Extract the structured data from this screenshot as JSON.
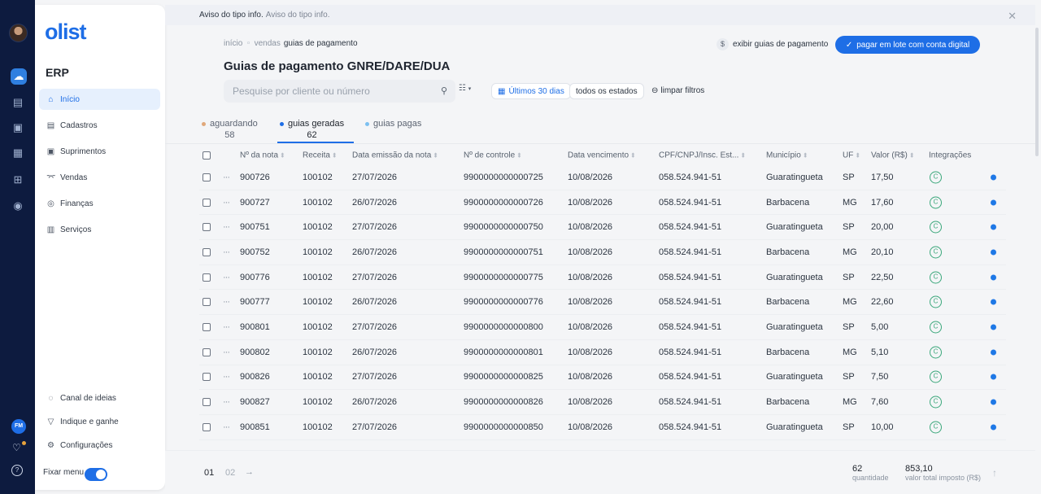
{
  "rail": {
    "icons": [
      "home-icon",
      "store-icon",
      "box-icon",
      "calendar-icon",
      "add-icon",
      "finance-icon"
    ],
    "user_initials": "FM"
  },
  "sidebar": {
    "logo": "olist",
    "section_title": "ERP",
    "items": [
      {
        "label": "Início",
        "icon": "home-icon",
        "active": true
      },
      {
        "label": "Cadastros",
        "icon": "document-icon",
        "active": false
      },
      {
        "label": "Suprimentos",
        "icon": "box-icon",
        "active": false
      },
      {
        "label": "Vendas",
        "icon": "cart-icon",
        "active": false
      },
      {
        "label": "Finanças",
        "icon": "money-icon",
        "active": false
      },
      {
        "label": "Serviços",
        "icon": "briefcase-icon",
        "active": false
      }
    ],
    "bottom_items": [
      {
        "label": "Canal de ideias",
        "icon": "lightbulb-icon"
      },
      {
        "label": "Indique e ganhe",
        "icon": "trophy-icon"
      },
      {
        "label": "Configurações",
        "icon": "gear-icon"
      }
    ],
    "fixar_menu_label": "Fixar menu",
    "fixar_menu_on": true
  },
  "banner": {
    "title": "Aviso do tipo info.",
    "text": "Aviso do tipo info."
  },
  "breadcrumb": [
    "início",
    "vendas",
    "guias de pagamento"
  ],
  "page_title": "Guias de pagamento GNRE/DARE/DUA",
  "actions": {
    "exibir_label": "exibir guias de pagamento",
    "primary_label": "pagar em lote com conta digital"
  },
  "search": {
    "placeholder": "Pesquise por cliente ou número",
    "value": ""
  },
  "filters": {
    "date_label": "Últimos 30 dias",
    "state_label": "todos os estados",
    "clear_label": "limpar filtros"
  },
  "tabs": [
    {
      "label": "aguardando",
      "count": "58",
      "dot_color": "#e0a87a"
    },
    {
      "label": "guias geradas",
      "count": "62",
      "dot_color": "#1e6ee6",
      "active": true
    },
    {
      "label": "guias pagas",
      "count": "",
      "dot_color": "#7cc0f0"
    }
  ],
  "table": {
    "columns": [
      "Nº da nota",
      "Receita",
      "Data emissão da nota",
      "Nº de controle",
      "Data vencimento",
      "CPF/CNPJ/Insc. Est...",
      "Município",
      "UF",
      "Valor (R$)",
      "Integrações"
    ],
    "rows": [
      {
        "nota": "900726",
        "receita": "100102",
        "emissao": "27/07/2026",
        "controle": "9900000000000725",
        "vencimento": "10/08/2026",
        "doc": "058.524.941-51",
        "municipio": "Guaratingueta",
        "uf": "SP",
        "valor": "17,50"
      },
      {
        "nota": "900727",
        "receita": "100102",
        "emissao": "26/07/2026",
        "controle": "9900000000000726",
        "vencimento": "10/08/2026",
        "doc": "058.524.941-51",
        "municipio": "Barbacena",
        "uf": "MG",
        "valor": "17,60"
      },
      {
        "nota": "900751",
        "receita": "100102",
        "emissao": "27/07/2026",
        "controle": "9900000000000750",
        "vencimento": "10/08/2026",
        "doc": "058.524.941-51",
        "municipio": "Guaratingueta",
        "uf": "SP",
        "valor": "20,00"
      },
      {
        "nota": "900752",
        "receita": "100102",
        "emissao": "26/07/2026",
        "controle": "9900000000000751",
        "vencimento": "10/08/2026",
        "doc": "058.524.941-51",
        "municipio": "Barbacena",
        "uf": "MG",
        "valor": "20,10"
      },
      {
        "nota": "900776",
        "receita": "100102",
        "emissao": "27/07/2026",
        "controle": "9900000000000775",
        "vencimento": "10/08/2026",
        "doc": "058.524.941-51",
        "municipio": "Guaratingueta",
        "uf": "SP",
        "valor": "22,50"
      },
      {
        "nota": "900777",
        "receita": "100102",
        "emissao": "26/07/2026",
        "controle": "9900000000000776",
        "vencimento": "10/08/2026",
        "doc": "058.524.941-51",
        "municipio": "Barbacena",
        "uf": "MG",
        "valor": "22,60"
      },
      {
        "nota": "900801",
        "receita": "100102",
        "emissao": "27/07/2026",
        "controle": "9900000000000800",
        "vencimento": "10/08/2026",
        "doc": "058.524.941-51",
        "municipio": "Guaratingueta",
        "uf": "SP",
        "valor": "5,00"
      },
      {
        "nota": "900802",
        "receita": "100102",
        "emissao": "26/07/2026",
        "controle": "9900000000000801",
        "vencimento": "10/08/2026",
        "doc": "058.524.941-51",
        "municipio": "Barbacena",
        "uf": "MG",
        "valor": "5,10"
      },
      {
        "nota": "900826",
        "receita": "100102",
        "emissao": "27/07/2026",
        "controle": "9900000000000825",
        "vencimento": "10/08/2026",
        "doc": "058.524.941-51",
        "municipio": "Guaratingueta",
        "uf": "SP",
        "valor": "7,50"
      },
      {
        "nota": "900827",
        "receita": "100102",
        "emissao": "26/07/2026",
        "controle": "9900000000000826",
        "vencimento": "10/08/2026",
        "doc": "058.524.941-51",
        "municipio": "Barbacena",
        "uf": "MG",
        "valor": "7,60"
      },
      {
        "nota": "900851",
        "receita": "100102",
        "emissao": "27/07/2026",
        "controle": "9900000000000850",
        "vencimento": "10/08/2026",
        "doc": "058.524.941-51",
        "municipio": "Guaratingueta",
        "uf": "SP",
        "valor": "10,00"
      }
    ]
  },
  "pagination": {
    "pages": [
      "01",
      "02"
    ],
    "current": "01"
  },
  "totals": {
    "quantidade": "62",
    "quantidade_label": "quantidade",
    "valor_total": "853,10",
    "valor_total_label": "valor total imposto (R$)"
  },
  "colors": {
    "accent": "#1e6ee6",
    "rail": "#0d1b3f",
    "integration": "#3aa77a"
  }
}
